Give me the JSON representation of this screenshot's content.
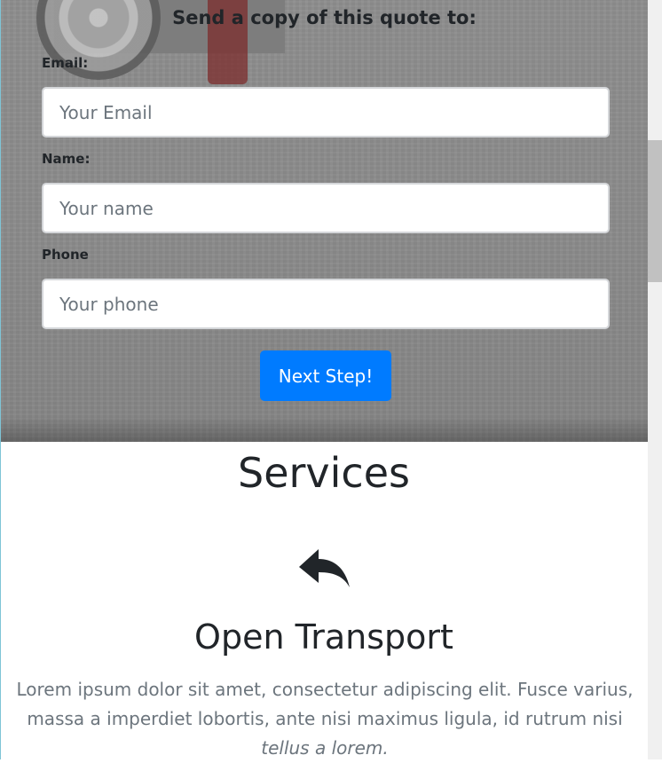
{
  "quote_form": {
    "title": "Send a copy of this quote to:",
    "fields": [
      {
        "label": "Email:",
        "placeholder": "Your Email",
        "value": ""
      },
      {
        "label": "Name:",
        "placeholder": "Your name",
        "value": ""
      },
      {
        "label": "Phone",
        "placeholder": "Your phone",
        "value": ""
      }
    ],
    "submit_label": "Next Step!"
  },
  "services": {
    "heading": "Services",
    "items": [
      {
        "icon": "reply-arrow-icon",
        "title": "Open Transport",
        "description": "Lorem ipsum dolor sit amet, consectetur adipiscing elit. Fusce varius, massa a imperdiet lobortis, ante nisi maximus ligula, id rutrum nisi",
        "description_emphasis": "tellus a lorem."
      }
    ]
  },
  "colors": {
    "primary_button": "#007bff",
    "text": "#212529",
    "muted_text": "#6c757d"
  }
}
